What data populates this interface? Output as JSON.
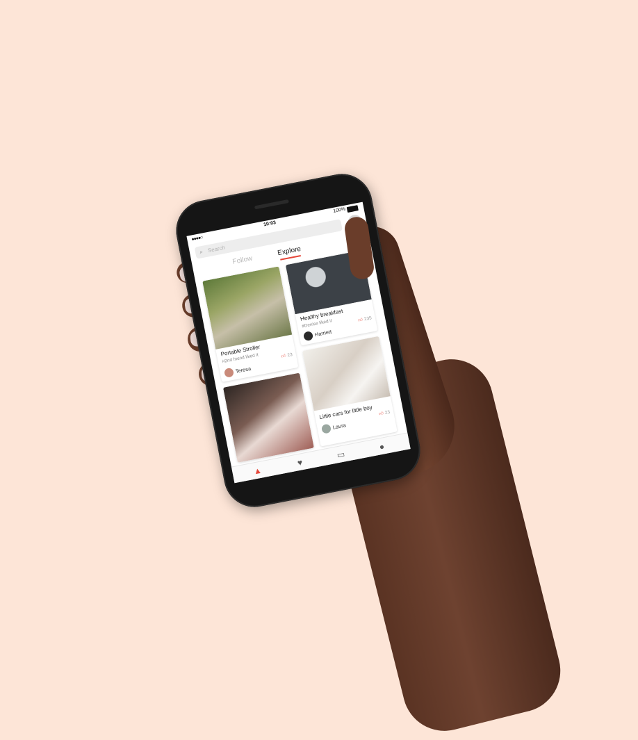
{
  "status": {
    "signal": "●●●●○",
    "time": "10:03",
    "battery": "100%"
  },
  "search": {
    "placeholder": "Search"
  },
  "tabs": [
    {
      "label": "Follow"
    },
    {
      "label": "Explore"
    }
  ],
  "cards": [
    {
      "title": "Portable Stroller",
      "sub": "#2nd friend liked it",
      "user": "Teresa",
      "likes": "23"
    },
    {
      "title": "Healthy breakfast",
      "sub": "#Denise liked it",
      "user": "Harriett",
      "likes": "235"
    },
    {
      "title": "Little cars for little boy",
      "sub": "",
      "user": "Laura",
      "likes": "23"
    }
  ],
  "icons": {
    "search": "magnifier",
    "camera": "camera",
    "like": "thumbs-up",
    "nav": [
      "fire",
      "heart",
      "chat",
      "profile"
    ]
  },
  "colors": {
    "accent": "#e5473a",
    "background": "#fde5d7"
  }
}
